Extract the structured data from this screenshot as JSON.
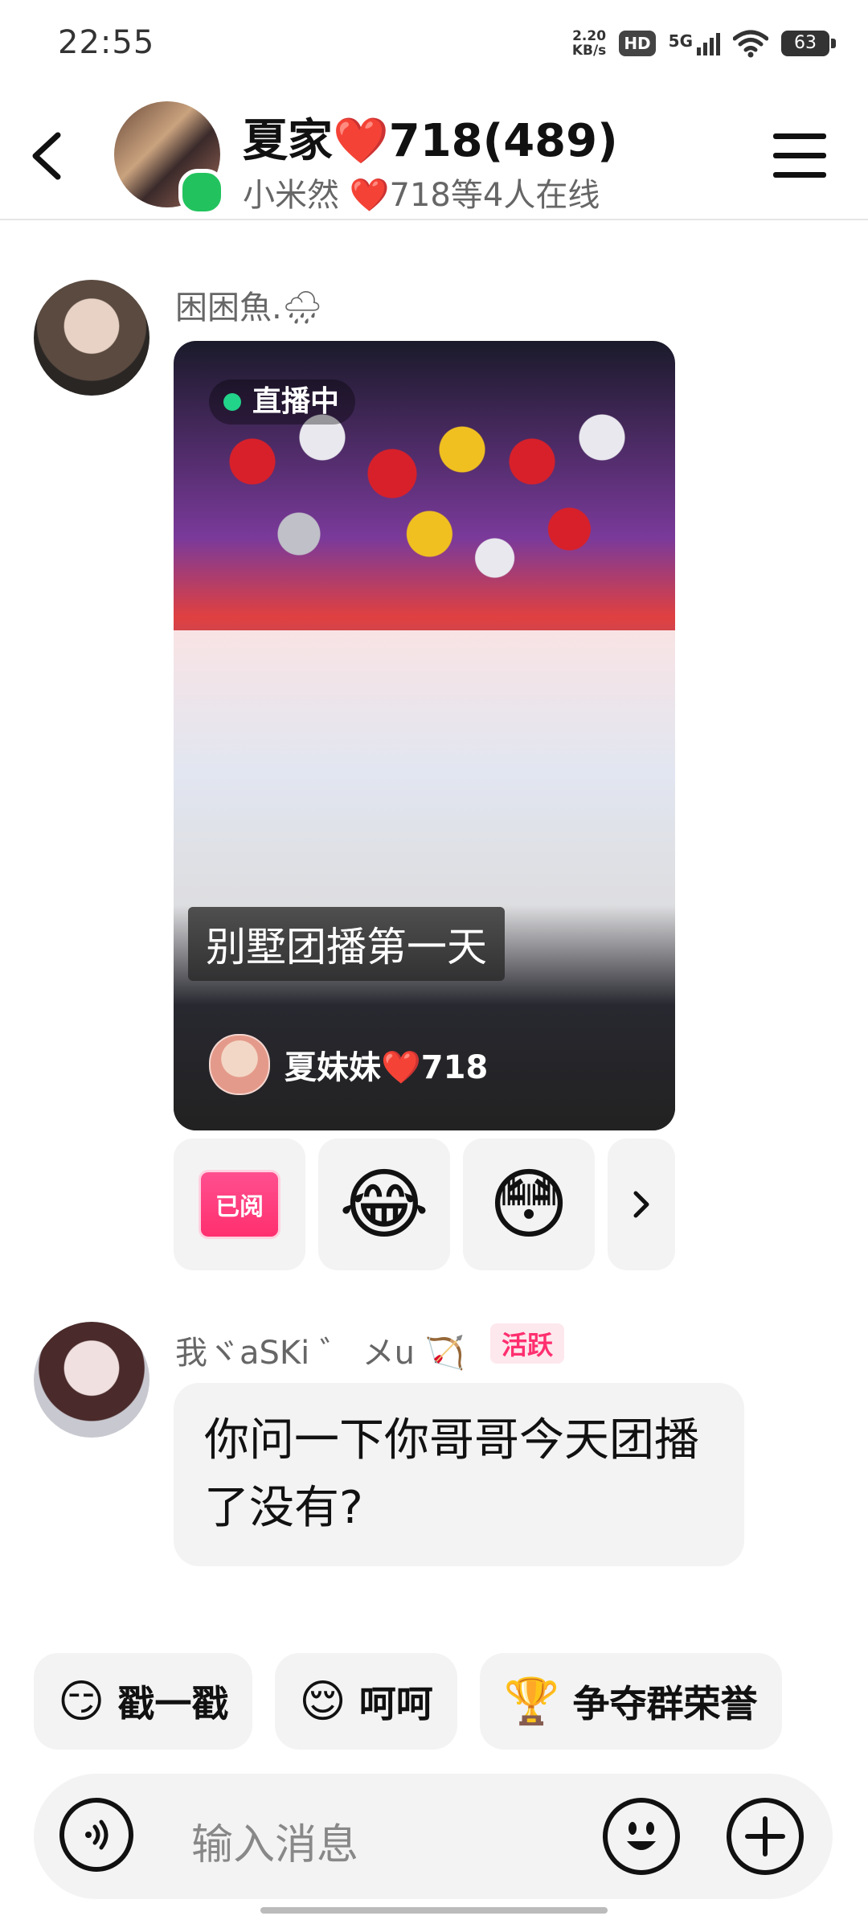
{
  "status_bar": {
    "time": "22:55",
    "speed_value": "2.20",
    "speed_unit": "KB/s",
    "hd": "HD",
    "network": "5G",
    "battery": "63"
  },
  "header": {
    "title": "夏家❤️718(489)",
    "subtitle": "小米然 ❤️718等4人在线"
  },
  "messages": [
    {
      "sender": "困困魚.🌧",
      "live_card": {
        "badge": "直播中",
        "caption": "别墅团播第一天",
        "host": "夏妹妹❤️718"
      },
      "reactions": {
        "read_label": "已阅",
        "emoji_1": "😂",
        "emoji_2": "😳"
      }
    },
    {
      "sender": "我ヾaSKi ゛ メu 🏹",
      "tag": "活跃",
      "text": "你问一下你哥哥今天团播了没有?"
    }
  ],
  "quick_actions": [
    {
      "emoji": "😏",
      "label": "戳一戳"
    },
    {
      "emoji": "😌",
      "label": "呵呵"
    },
    {
      "emoji": "🏆",
      "label": "争夺群荣誉"
    }
  ],
  "input": {
    "placeholder": "输入消息"
  },
  "colors": {
    "online": "#22c35e",
    "accent_pink": "#ff2f6f",
    "bubble_bg": "#f3f3f3"
  }
}
